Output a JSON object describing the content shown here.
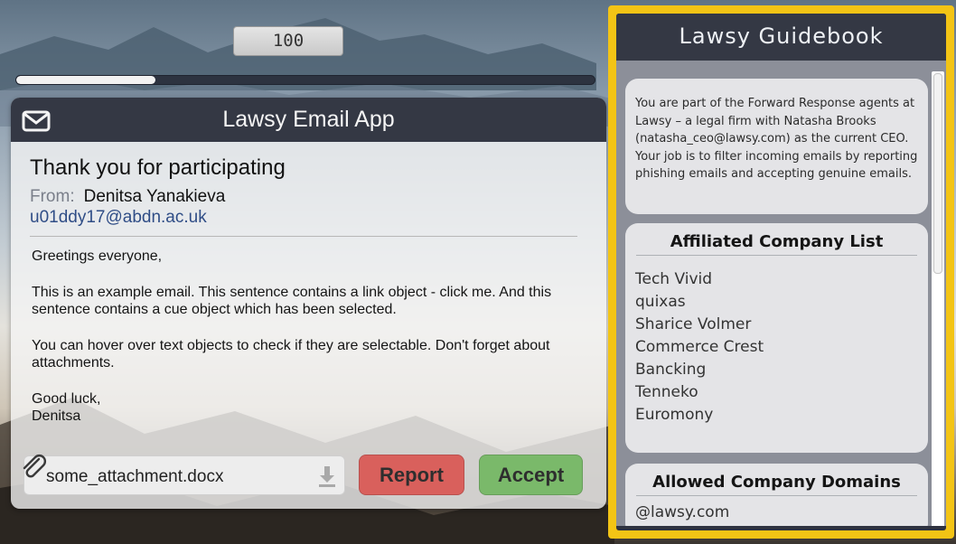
{
  "score": "100",
  "progress": 0.24,
  "email_app": {
    "title": "Lawsy Email App",
    "subject": "Thank you for participating",
    "from_label": "From:",
    "from_name": "Denitsa Yanakieva",
    "from_email": "u01ddy17@abdn.ac.uk",
    "body": [
      "Greetings everyone,",
      "This is an example email. This sentence contains a link object - click me. And this sentence contains a cue object which has been selected.",
      "You can hover over text objects to check if they are selectable. Don't forget about attachments.",
      "Good luck,\nDenitsa"
    ],
    "attachment_name": "some_attachment.docx",
    "report_label": "Report",
    "accept_label": "Accept"
  },
  "guidebook": {
    "title": "Lawsy Guidebook",
    "intro": "You are part of the Forward Response agents at Lawsy – a legal firm with Natasha Brooks (natasha_ceo@lawsy.com) as the current CEO. Your job is to filter incoming emails by reporting phishing emails and accepting genuine emails.",
    "companies_title": "Affiliated Company List",
    "companies": [
      "Tech Vivid",
      "quixas",
      "Sharice Volmer",
      "Commerce Crest",
      "Bancking",
      "Tenneko",
      "Euromony"
    ],
    "domains_title": "Allowed Company Domains",
    "domains": [
      "@lawsy.com"
    ]
  },
  "colors": {
    "accent_border": "#f3c415",
    "header_bg": "#343844",
    "report": "#d9605c",
    "accept": "#7ab96a",
    "link": "#2f4d86"
  },
  "icons": [
    "mail-icon",
    "paperclip-icon",
    "download-icon"
  ]
}
